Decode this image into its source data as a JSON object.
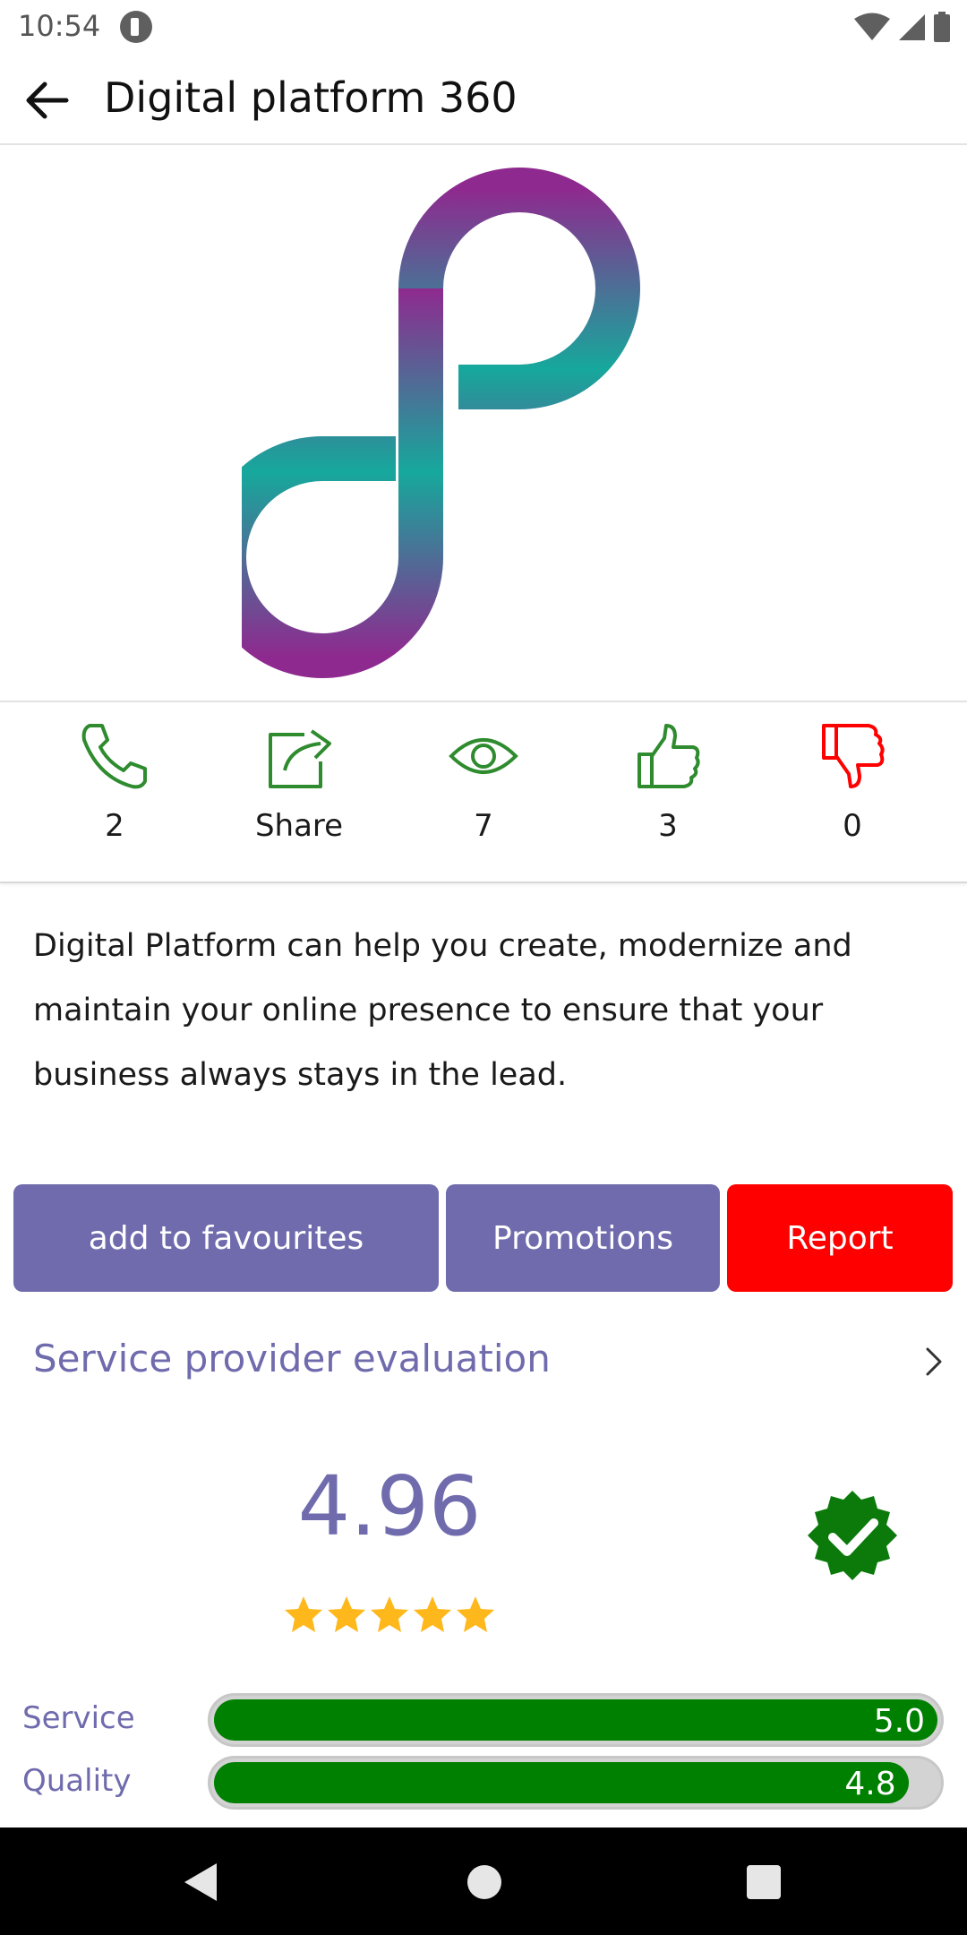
{
  "status_bar": {
    "time": "10:54"
  },
  "app_bar": {
    "title": "Digital platform 360"
  },
  "stats": {
    "calls": "2",
    "share_label": "Share",
    "views": "7",
    "likes": "3",
    "dislikes": "0"
  },
  "description": "Digital Platform can help you create, modernize and maintain your online presence to ensure that your business always stays in the lead.",
  "buttons": {
    "favourites": "add to favourites",
    "promotions": "Promotions",
    "report": "Report"
  },
  "evaluation": {
    "link_label": "Service provider evaluation",
    "score": "4.96",
    "stars": 5,
    "rows": [
      {
        "label": "Service",
        "value": "5.0",
        "fraction": 1.0
      },
      {
        "label": "Quality",
        "value": "4.8",
        "fraction": 0.96
      }
    ]
  },
  "colors": {
    "accent": "#6f6bad",
    "report": "#ff0000",
    "stat_icon": "#2e8b2e",
    "dislike_icon": "#ff0000",
    "bar_fill": "#008000",
    "star": "#ffb81c"
  },
  "icons": {
    "back": "back-arrow-icon",
    "phone": "phone-icon",
    "share": "share-icon",
    "views": "eye-icon",
    "like": "thumbs-up-icon",
    "dislike": "thumbs-down-icon",
    "chevron": "chevron-right-icon",
    "verified": "verified-badge-icon"
  }
}
